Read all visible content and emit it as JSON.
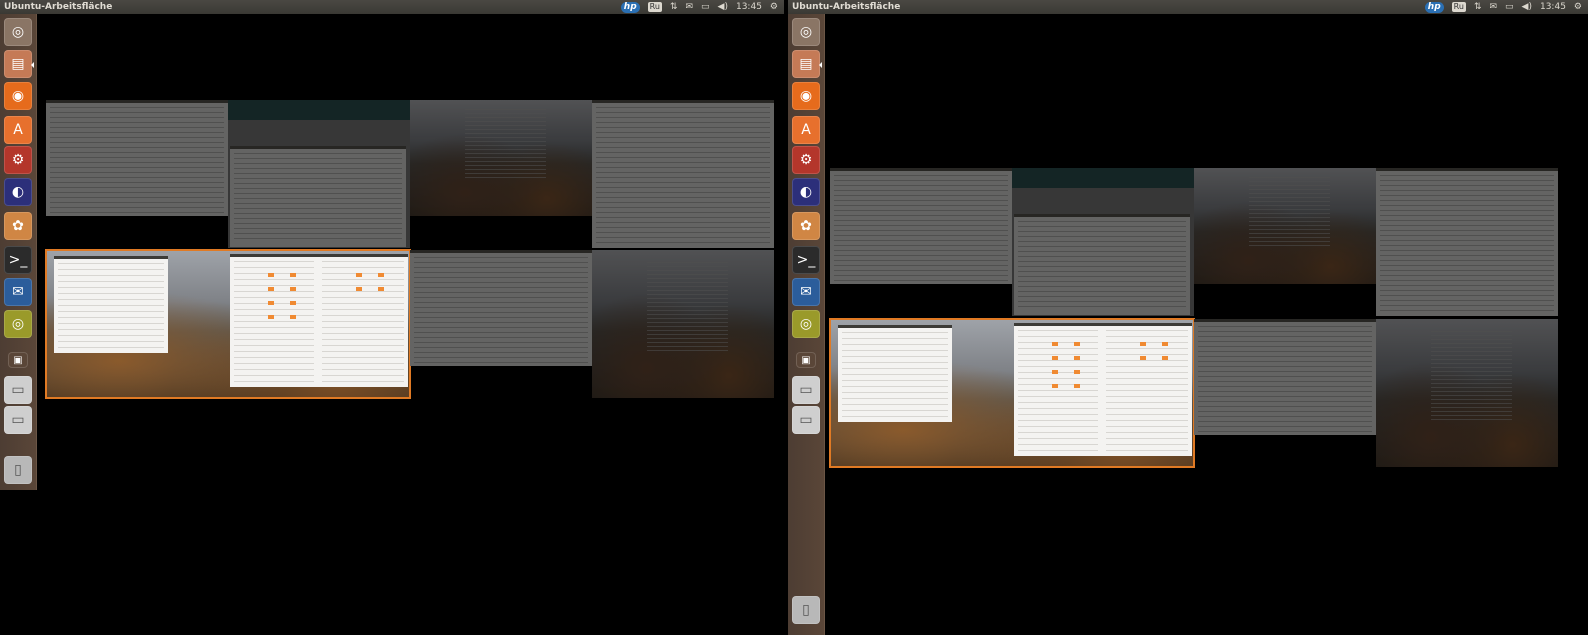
{
  "panel": {
    "title": "Ubuntu-Arbeitsfläche",
    "hp_label": "hp",
    "keyboard_layout": "Ru",
    "clock": "13:45",
    "network_symbol": "⇅",
    "mail_symbol": "✉",
    "battery_symbol": "▭",
    "volume_symbol": "◀)",
    "settings_symbol": "⚙"
  },
  "launcher": {
    "items": [
      {
        "name": "dash-home-icon",
        "glyph": "◎",
        "color": "#8a7565"
      },
      {
        "name": "files-icon",
        "glyph": "▤",
        "color": "#c57a56"
      },
      {
        "name": "firefox-icon",
        "glyph": "◉",
        "color": "#e66b1c"
      },
      {
        "name": "software-center-icon",
        "glyph": "A",
        "color": "#e7702d"
      },
      {
        "name": "system-settings-icon",
        "glyph": "⚙",
        "color": "#b4362b"
      },
      {
        "name": "eclipse-icon",
        "glyph": "◐",
        "color": "#2c2f7a"
      },
      {
        "name": "image-viewer-icon",
        "glyph": "✿",
        "color": "#d08644"
      },
      {
        "name": "terminal-icon",
        "glyph": ">_",
        "color": "#2b2b2b"
      },
      {
        "name": "thunderbird-icon",
        "glyph": "✉",
        "color": "#2b5d9b"
      },
      {
        "name": "rhythmbox-icon",
        "glyph": "◎",
        "color": "#9a9a2a"
      },
      {
        "name": "workspace-switcher-icon",
        "glyph": "▣",
        "color": "#5a4638"
      },
      {
        "name": "drive-icon-1",
        "glyph": "▭",
        "color": "#cfcfcf"
      },
      {
        "name": "drive-icon-2",
        "glyph": "▭",
        "color": "#cfcfcf"
      },
      {
        "name": "trash-icon",
        "glyph": "▯",
        "color": "#b8b8b8"
      }
    ]
  },
  "colors": {
    "selection": "#e07a24",
    "panel": "#3c3b37",
    "launcher": "#5a4638"
  }
}
